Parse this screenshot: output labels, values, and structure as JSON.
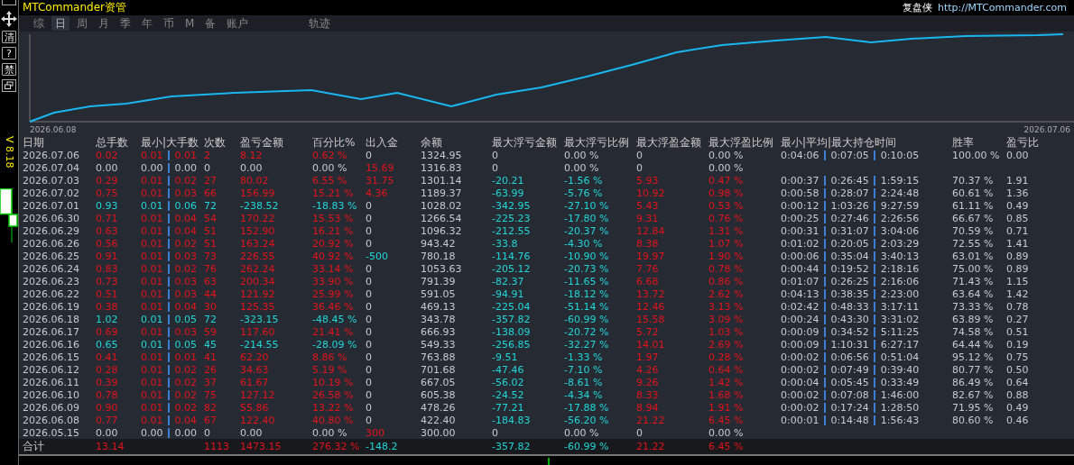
{
  "header": {
    "brand": "MTCommander资管",
    "right_label": "复盘侠",
    "right_link": "http://MTCommander.com"
  },
  "sidebar": {
    "buttons": [
      {
        "label": "清"
      },
      {
        "label": "?"
      },
      {
        "label": "禁"
      }
    ],
    "version": "V 8.18"
  },
  "tabs": [
    {
      "label": "综",
      "selected": false
    },
    {
      "label": "日",
      "selected": true
    },
    {
      "label": "周",
      "selected": false
    },
    {
      "label": "月",
      "selected": false
    },
    {
      "label": "季",
      "selected": false
    },
    {
      "label": "年",
      "selected": false
    },
    {
      "label": "币",
      "selected": false
    },
    {
      "label": "M",
      "selected": false
    },
    {
      "label": "备",
      "selected": false
    },
    {
      "label": "账户",
      "selected": false
    },
    {
      "label": "轨迹",
      "selected": false
    }
  ],
  "chart": {
    "start_label": "2026.06.08",
    "end_label": "2026.07.06"
  },
  "table": {
    "columns": [
      "日期",
      "总手数",
      "最小|大手数",
      "次数",
      "盈亏金额",
      "百分比%",
      "出入金",
      "余额",
      "最大浮亏金额",
      "最大浮亏比例",
      "最大浮盈金额",
      "最大浮盈比例",
      "最小|平均|最大持仓时间",
      "胜率",
      "盈亏比"
    ],
    "rows": [
      {
        "date": "2026.07.06",
        "lots": "0.02",
        "range": [
          "0.01",
          "0.01"
        ],
        "count": "2",
        "pnl": "8.12",
        "pct": "0.62 %",
        "color": "#e3121b",
        "cash": {
          "text": "0",
          "color": "#c5cad3"
        },
        "balance": "1324.95",
        "max_loss": "0",
        "max_loss_pct": "0.00 %",
        "max_gain": "0",
        "max_gain_pct": "0.00 %",
        "float_active": false,
        "hold": [
          "0:04:06",
          "0:07:05",
          "0:10:05"
        ],
        "win_rate": "100.00 %",
        "pl_ratio": "0.00"
      },
      {
        "date": "2026.07.04",
        "lots": "0.00",
        "range": [
          "0.00",
          "0.00"
        ],
        "count": "0",
        "pnl": "0.00",
        "pct": "0.00 %",
        "color": "#c5cad3",
        "cash": {
          "text": "15.69",
          "color": "#e3121b"
        },
        "balance": "1316.83",
        "max_loss": "0",
        "max_loss_pct": "0.00 %",
        "max_gain": "0",
        "max_gain_pct": "0.00 %",
        "float_active": false
      },
      {
        "date": "2026.07.03",
        "lots": "0.29",
        "range": [
          "0.01",
          "0.02"
        ],
        "count": "27",
        "pnl": "80.02",
        "pct": "6.55 %",
        "color": "#e3121b",
        "cash": {
          "text": "31.75",
          "color": "#e3121b"
        },
        "balance": "1301.14",
        "max_loss": "-20.21",
        "max_loss_pct": "-1.56 %",
        "max_gain": "5.93",
        "max_gain_pct": "0.47 %",
        "float_active": true,
        "hold": [
          "0:00:37",
          "0:26:45",
          "1:59:15"
        ],
        "win_rate": "70.37 %",
        "pl_ratio": "1.91"
      },
      {
        "date": "2026.07.02",
        "lots": "0.75",
        "range": [
          "0.01",
          "0.03"
        ],
        "count": "66",
        "pnl": "156.99",
        "pct": "15.21 %",
        "color": "#e3121b",
        "cash": {
          "text": "4.36",
          "color": "#e3121b"
        },
        "balance": "1189.37",
        "max_loss": "-63.99",
        "max_loss_pct": "-5.76 %",
        "max_gain": "10.92",
        "max_gain_pct": "0.98 %",
        "float_active": true,
        "hold": [
          "0:00:58",
          "0:28:07",
          "2:24:48"
        ],
        "win_rate": "60.61 %",
        "pl_ratio": "1.36"
      },
      {
        "date": "2026.07.01",
        "lots": "0.93",
        "range": [
          "0.01",
          "0.06"
        ],
        "count": "72",
        "pnl": "-238.52",
        "pct": "-18.83 %",
        "color": "#22d6d6",
        "cash": {
          "text": "0",
          "color": "#c5cad3"
        },
        "balance": "1028.02",
        "max_loss": "-342.95",
        "max_loss_pct": "-27.10 %",
        "max_gain": "5.43",
        "max_gain_pct": "0.53 %",
        "float_active": true,
        "hold": [
          "0:00:12",
          "1:03:26",
          "9:27:59"
        ],
        "win_rate": "61.11 %",
        "pl_ratio": "0.49"
      },
      {
        "date": "2026.06.30",
        "lots": "0.71",
        "range": [
          "0.01",
          "0.04"
        ],
        "count": "54",
        "pnl": "170.22",
        "pct": "15.53 %",
        "color": "#e3121b",
        "cash": {
          "text": "0",
          "color": "#c5cad3"
        },
        "balance": "1266.54",
        "max_loss": "-225.23",
        "max_loss_pct": "-17.80 %",
        "max_gain": "9.31",
        "max_gain_pct": "0.76 %",
        "float_active": true,
        "hold": [
          "0:00:25",
          "0:27:46",
          "2:26:56"
        ],
        "win_rate": "66.67 %",
        "pl_ratio": "0.85"
      },
      {
        "date": "2026.06.29",
        "lots": "0.63",
        "range": [
          "0.01",
          "0.04"
        ],
        "count": "51",
        "pnl": "152.90",
        "pct": "16.21 %",
        "color": "#e3121b",
        "cash": {
          "text": "0",
          "color": "#c5cad3"
        },
        "balance": "1096.32",
        "max_loss": "-212.55",
        "max_loss_pct": "-20.37 %",
        "max_gain": "12.84",
        "max_gain_pct": "1.31 %",
        "float_active": true,
        "hold": [
          "0:00:31",
          "0:31:07",
          "3:04:06"
        ],
        "win_rate": "70.59 %",
        "pl_ratio": "0.71"
      },
      {
        "date": "2026.06.26",
        "lots": "0.56",
        "range": [
          "0.01",
          "0.02"
        ],
        "count": "51",
        "pnl": "163.24",
        "pct": "20.92 %",
        "color": "#e3121b",
        "cash": {
          "text": "0",
          "color": "#c5cad3"
        },
        "balance": "943.42",
        "max_loss": "-33.8",
        "max_loss_pct": "-4.30 %",
        "max_gain": "8.38",
        "max_gain_pct": "1.07 %",
        "float_active": true,
        "hold": [
          "0:01:02",
          "0:20:05",
          "2:03:29"
        ],
        "win_rate": "72.55 %",
        "pl_ratio": "1.41"
      },
      {
        "date": "2026.06.25",
        "lots": "0.91",
        "range": [
          "0.01",
          "0.03"
        ],
        "count": "73",
        "pnl": "226.55",
        "pct": "40.92 %",
        "color": "#e3121b",
        "cash": {
          "text": "-500",
          "color": "#22d6d6"
        },
        "balance": "780.18",
        "max_loss": "-114.76",
        "max_loss_pct": "-10.90 %",
        "max_gain": "19.97",
        "max_gain_pct": "1.90 %",
        "float_active": true,
        "hold": [
          "0:00:06",
          "0:35:04",
          "3:40:13"
        ],
        "win_rate": "63.01 %",
        "pl_ratio": "0.89"
      },
      {
        "date": "2026.06.24",
        "lots": "0.83",
        "range": [
          "0.01",
          "0.02"
        ],
        "count": "76",
        "pnl": "262.24",
        "pct": "33.14 %",
        "color": "#e3121b",
        "cash": {
          "text": "0",
          "color": "#c5cad3"
        },
        "balance": "1053.63",
        "max_loss": "-205.12",
        "max_loss_pct": "-20.73 %",
        "max_gain": "7.76",
        "max_gain_pct": "0.78 %",
        "float_active": true,
        "hold": [
          "0:00:44",
          "0:19:52",
          "2:18:16"
        ],
        "win_rate": "75.00 %",
        "pl_ratio": "0.89"
      },
      {
        "date": "2026.06.23",
        "lots": "0.73",
        "range": [
          "0.01",
          "0.03"
        ],
        "count": "63",
        "pnl": "200.34",
        "pct": "33.90 %",
        "color": "#e3121b",
        "cash": {
          "text": "0",
          "color": "#c5cad3"
        },
        "balance": "791.39",
        "max_loss": "-82.37",
        "max_loss_pct": "-11.65 %",
        "max_gain": "6.68",
        "max_gain_pct": "0.86 %",
        "float_active": true,
        "hold": [
          "0:01:07",
          "0:26:25",
          "2:16:06"
        ],
        "win_rate": "71.43 %",
        "pl_ratio": "1.15"
      },
      {
        "date": "2026.06.22",
        "lots": "0.51",
        "range": [
          "0.01",
          "0.03"
        ],
        "count": "44",
        "pnl": "121.92",
        "pct": "25.99 %",
        "color": "#e3121b",
        "cash": {
          "text": "0",
          "color": "#c5cad3"
        },
        "balance": "591.05",
        "max_loss": "-94.91",
        "max_loss_pct": "-18.12 %",
        "max_gain": "13.72",
        "max_gain_pct": "2.62 %",
        "float_active": true,
        "hold": [
          "0:04:13",
          "0:38:35",
          "2:23:00"
        ],
        "win_rate": "63.64 %",
        "pl_ratio": "1.42"
      },
      {
        "date": "2026.06.19",
        "lots": "0.38",
        "range": [
          "0.01",
          "0.04"
        ],
        "count": "30",
        "pnl": "125.35",
        "pct": "36.46 %",
        "color": "#e3121b",
        "cash": {
          "text": "0",
          "color": "#c5cad3"
        },
        "balance": "469.13",
        "max_loss": "-225.04",
        "max_loss_pct": "-51.14 %",
        "max_gain": "12.46",
        "max_gain_pct": "3.13 %",
        "float_active": true,
        "hold": [
          "0:02:42",
          "0:48:33",
          "3:17:11"
        ],
        "win_rate": "73.33 %",
        "pl_ratio": "0.78"
      },
      {
        "date": "2026.06.18",
        "lots": "1.02",
        "range": [
          "0.01",
          "0.05"
        ],
        "count": "72",
        "pnl": "-323.15",
        "pct": "-48.45 %",
        "color": "#22d6d6",
        "cash": {
          "text": "0",
          "color": "#c5cad3"
        },
        "balance": "343.78",
        "max_loss": "-357.82",
        "max_loss_pct": "-60.99 %",
        "max_gain": "15.58",
        "max_gain_pct": "3.09 %",
        "float_active": true,
        "hold": [
          "0:00:24",
          "0:43:30",
          "3:31:02"
        ],
        "win_rate": "63.89 %",
        "pl_ratio": "0.27"
      },
      {
        "date": "2026.06.17",
        "lots": "0.69",
        "range": [
          "0.01",
          "0.03"
        ],
        "count": "59",
        "pnl": "117.60",
        "pct": "21.41 %",
        "color": "#e3121b",
        "cash": {
          "text": "0",
          "color": "#c5cad3"
        },
        "balance": "666.93",
        "max_loss": "-138.09",
        "max_loss_pct": "-20.72 %",
        "max_gain": "5.72",
        "max_gain_pct": "1.03 %",
        "float_active": true,
        "hold": [
          "0:00:09",
          "0:34:52",
          "5:11:25"
        ],
        "win_rate": "74.58 %",
        "pl_ratio": "0.51"
      },
      {
        "date": "2026.06.16",
        "lots": "0.65",
        "range": [
          "0.01",
          "0.05"
        ],
        "count": "45",
        "pnl": "-214.55",
        "pct": "-28.09 %",
        "color": "#22d6d6",
        "cash": {
          "text": "0",
          "color": "#c5cad3"
        },
        "balance": "549.33",
        "max_loss": "-256.85",
        "max_loss_pct": "-32.27 %",
        "max_gain": "14.01",
        "max_gain_pct": "2.69 %",
        "float_active": true,
        "hold": [
          "0:00:09",
          "1:10:31",
          "6:27:17"
        ],
        "win_rate": "64.44 %",
        "pl_ratio": "0.19"
      },
      {
        "date": "2026.06.15",
        "lots": "0.41",
        "range": [
          "0.01",
          "0.01"
        ],
        "count": "41",
        "pnl": "62.20",
        "pct": "8.86 %",
        "color": "#e3121b",
        "cash": {
          "text": "0",
          "color": "#c5cad3"
        },
        "balance": "763.88",
        "max_loss": "-9.51",
        "max_loss_pct": "-1.33 %",
        "max_gain": "1.97",
        "max_gain_pct": "0.28 %",
        "float_active": true,
        "hold": [
          "0:00:02",
          "0:06:56",
          "0:51:04"
        ],
        "win_rate": "95.12 %",
        "pl_ratio": "0.75"
      },
      {
        "date": "2026.06.12",
        "lots": "0.28",
        "range": [
          "0.01",
          "0.02"
        ],
        "count": "26",
        "pnl": "34.63",
        "pct": "5.19 %",
        "color": "#e3121b",
        "cash": {
          "text": "0",
          "color": "#c5cad3"
        },
        "balance": "701.68",
        "max_loss": "-47.46",
        "max_loss_pct": "-7.10 %",
        "max_gain": "4.26",
        "max_gain_pct": "0.64 %",
        "float_active": true,
        "hold": [
          "0:00:02",
          "0:07:49",
          "0:39:40"
        ],
        "win_rate": "80.77 %",
        "pl_ratio": "0.50"
      },
      {
        "date": "2026.06.11",
        "lots": "0.39",
        "range": [
          "0.01",
          "0.02"
        ],
        "count": "37",
        "pnl": "61.67",
        "pct": "10.19 %",
        "color": "#e3121b",
        "cash": {
          "text": "0",
          "color": "#c5cad3"
        },
        "balance": "667.05",
        "max_loss": "-56.02",
        "max_loss_pct": "-8.61 %",
        "max_gain": "9.26",
        "max_gain_pct": "1.42 %",
        "float_active": true,
        "hold": [
          "0:00:04",
          "0:05:45",
          "0:33:49"
        ],
        "win_rate": "86.49 %",
        "pl_ratio": "0.64"
      },
      {
        "date": "2026.06.10",
        "lots": "0.78",
        "range": [
          "0.01",
          "0.02"
        ],
        "count": "75",
        "pnl": "127.12",
        "pct": "26.58 %",
        "color": "#e3121b",
        "cash": {
          "text": "0",
          "color": "#c5cad3"
        },
        "balance": "605.38",
        "max_loss": "-24.52",
        "max_loss_pct": "-4.34 %",
        "max_gain": "8.33",
        "max_gain_pct": "1.68 %",
        "float_active": true,
        "hold": [
          "0:00:02",
          "0:07:08",
          "1:46:00"
        ],
        "win_rate": "82.67 %",
        "pl_ratio": "0.88"
      },
      {
        "date": "2026.06.09",
        "lots": "0.90",
        "range": [
          "0.01",
          "0.02"
        ],
        "count": "82",
        "pnl": "55.86",
        "pct": "13.22 %",
        "color": "#e3121b",
        "cash": {
          "text": "0",
          "color": "#c5cad3"
        },
        "balance": "478.26",
        "max_loss": "-77.21",
        "max_loss_pct": "-17.88 %",
        "max_gain": "8.94",
        "max_gain_pct": "1.91 %",
        "float_active": true,
        "hold": [
          "0:00:02",
          "0:17:24",
          "1:28:50"
        ],
        "win_rate": "71.95 %",
        "pl_ratio": "0.49"
      },
      {
        "date": "2026.06.08",
        "lots": "0.77",
        "range": [
          "0.01",
          "0.04"
        ],
        "count": "67",
        "pnl": "122.40",
        "pct": "40.80 %",
        "color": "#e3121b",
        "cash": {
          "text": "0",
          "color": "#c5cad3"
        },
        "balance": "422.40",
        "max_loss": "-184.83",
        "max_loss_pct": "-56.20 %",
        "max_gain": "21.22",
        "max_gain_pct": "6.45 %",
        "float_active": true,
        "hold": [
          "0:00:01",
          "0:14:48",
          "1:56:43"
        ],
        "win_rate": "80.60 %",
        "pl_ratio": "0.46"
      },
      {
        "date": "2026.05.15",
        "lots": "0.00",
        "range": [
          "0.00",
          "0.00"
        ],
        "count": "0",
        "pnl": "0.00",
        "pct": "0.00 %",
        "color": "#c5cad3",
        "cash": {
          "text": "300",
          "color": "#e3121b"
        },
        "balance": "300.00",
        "max_loss": "0",
        "max_loss_pct": "0.00 %",
        "max_gain": "0",
        "max_gain_pct": "0.00 %",
        "float_active": false
      }
    ],
    "total": {
      "label": "合计",
      "lots": "13.14",
      "count": "1113",
      "pnl": "1473.15",
      "pct": "276.32 %",
      "color": "#e3121b",
      "cash": {
        "text": "-148.2",
        "color": "#22d6d6"
      },
      "max_loss": "-357.82",
      "max_loss_pct": "-60.99 %",
      "max_gain": "21.22",
      "max_gain_pct": "6.45 %",
      "float_active": true
    }
  }
}
